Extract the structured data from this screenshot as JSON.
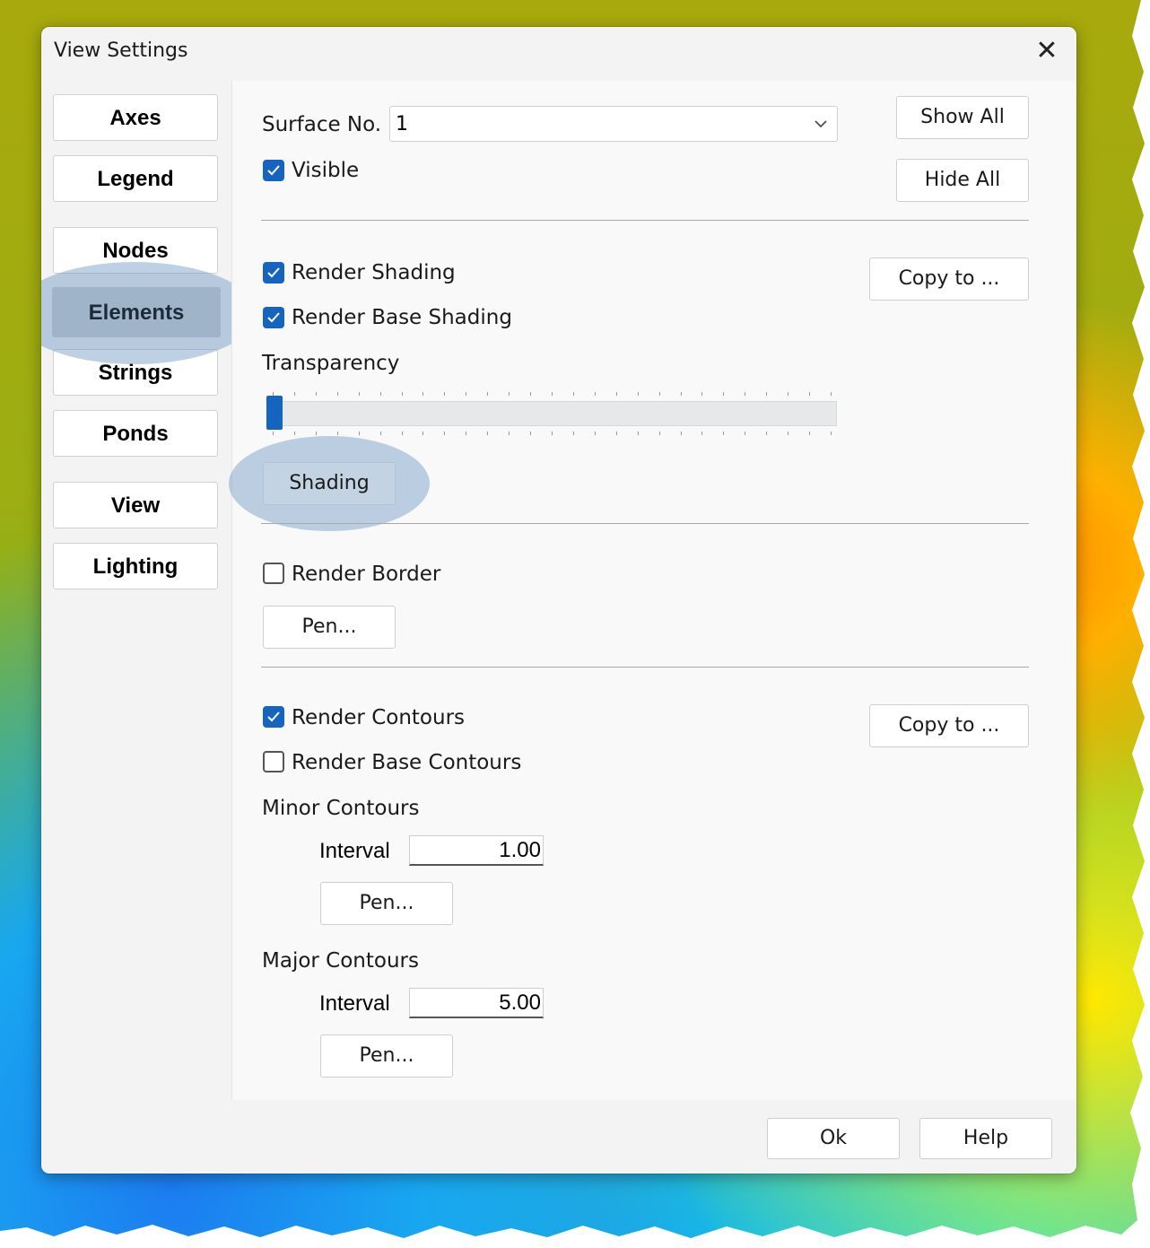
{
  "window": {
    "title": "View Settings",
    "close_icon": "close-icon"
  },
  "nav": [
    {
      "label": "Axes",
      "active": false
    },
    {
      "label": "Legend",
      "active": false
    },
    {
      "label": "Nodes",
      "active": false
    },
    {
      "label": "Elements",
      "active": true
    },
    {
      "label": "Strings",
      "active": false
    },
    {
      "label": "Ponds",
      "active": false
    },
    {
      "label": "View",
      "active": false
    },
    {
      "label": "Lighting",
      "active": false
    }
  ],
  "surface": {
    "label": "Surface No.",
    "value": "1",
    "visible_label": "Visible",
    "visible": true,
    "show_all": "Show All",
    "hide_all": "Hide All"
  },
  "shading": {
    "render_shading": "Render Shading",
    "render_shading_checked": true,
    "render_base_shading": "Render Base Shading",
    "render_base_shading_checked": true,
    "copy_to": "Copy to ...",
    "transparency_label": "Transparency",
    "transparency_value": 0,
    "shading_button": "Shading"
  },
  "border": {
    "render_border": "Render Border",
    "render_border_checked": false,
    "pen": "Pen..."
  },
  "contours": {
    "render_contours": "Render Contours",
    "render_contours_checked": true,
    "render_base_contours": "Render Base Contours",
    "render_base_contours_checked": false,
    "copy_to": "Copy to ...",
    "minor_label": "Minor Contours",
    "minor_interval_label": "Interval",
    "minor_interval": "1.00",
    "minor_pen": "Pen...",
    "major_label": "Major Contours",
    "major_interval_label": "Interval",
    "major_interval": "5.00",
    "major_pen": "Pen..."
  },
  "footer": {
    "ok": "Ok",
    "help": "Help"
  },
  "colors": {
    "accent": "#1565c0",
    "active_nav": "#9fb4c8",
    "highlight": "#6e96c3"
  }
}
